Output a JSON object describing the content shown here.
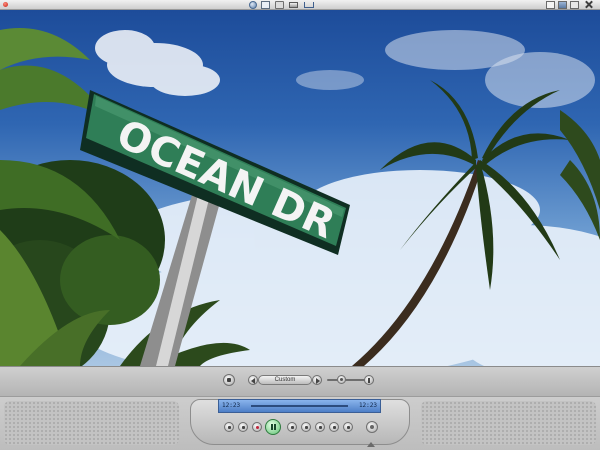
{
  "topbar": {
    "icons": [
      "app-icon",
      "globe-icon",
      "mail-icon",
      "folder-icon",
      "drive-icon",
      "cart-icon"
    ],
    "window_controls": [
      "minimize-icon",
      "restore-icon",
      "fullscreen-icon",
      "close-icon"
    ]
  },
  "video": {
    "sign_text": "OCEAN DR"
  },
  "controls": {
    "mode_label": "Custom",
    "volume_level": 0.3,
    "time_elapsed": "12:23",
    "time_total": "12:23",
    "progress": 0.0
  },
  "colors": {
    "sky": "#2f66b2",
    "sign_green": "#2f7e57",
    "timebar_blue": "#6d9ade",
    "play_green": "#5cc070"
  }
}
